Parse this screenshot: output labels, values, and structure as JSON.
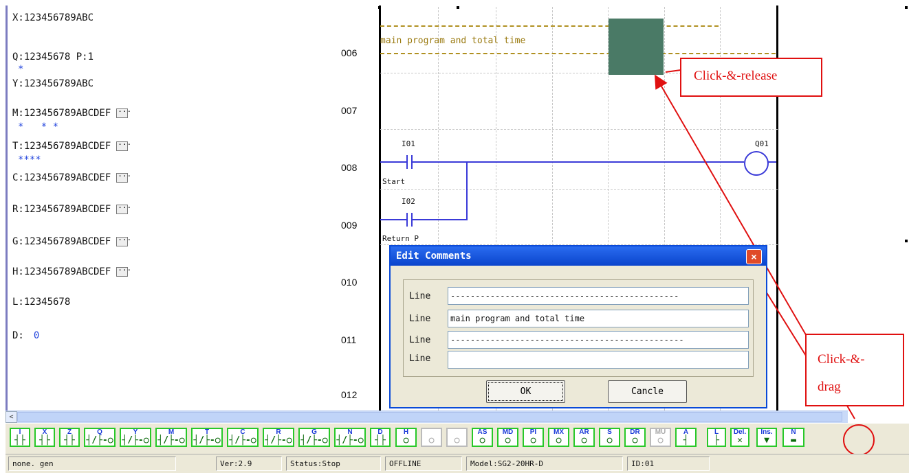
{
  "registers": [
    {
      "text": "X:123456789ABC",
      "more": false
    },
    {
      "text": "Q:12345678 P:1",
      "more": false
    },
    {
      "text": "Y:123456789ABC",
      "more": false
    },
    {
      "text": "M:123456789ABCDEF",
      "more": true
    },
    {
      "text": "T:123456789ABCDEF",
      "more": true
    },
    {
      "text": "C:123456789ABCDEF",
      "more": true
    },
    {
      "text": "R:123456789ABCDEF",
      "more": true
    },
    {
      "text": "G:123456789ABCDEF",
      "more": true
    },
    {
      "text": "H:123456789ABCDEF",
      "more": true
    },
    {
      "text": "L:12345678",
      "more": false
    },
    {
      "text": "D:",
      "more": false,
      "value": "0"
    }
  ],
  "register_markers": [
    "*",
    "*   * *",
    "****"
  ],
  "row_numbers": [
    "006",
    "007",
    "008",
    "009",
    "010",
    "011",
    "012"
  ],
  "ladder": {
    "comment_text": "main program and total time",
    "contacts": [
      {
        "id": "I01",
        "comment": "Start"
      },
      {
        "id": "I02",
        "comment": "Return P"
      }
    ],
    "coil": "Q01"
  },
  "callouts": {
    "release": "Click-&-release",
    "drag_line1": "Click-&-",
    "drag_line2": "drag"
  },
  "dialog": {
    "title": "Edit Comments",
    "close_glyph": "×",
    "lines": [
      {
        "label": "Line",
        "value": "----------------------------------------------"
      },
      {
        "label": "Line",
        "value": "main program and total time"
      },
      {
        "label": "Line",
        "value": "-----------------------------------------------"
      },
      {
        "label": "Line",
        "value": ""
      }
    ],
    "ok_label": "OK",
    "cancel_label": "Cancle"
  },
  "scrollbar": {
    "left_arrow": "<"
  },
  "toolbar": {
    "buttons": [
      {
        "name": "contact-i",
        "top": "I",
        "sym": "┤├"
      },
      {
        "name": "contact-x",
        "top": "X",
        "sym": "┤├"
      },
      {
        "name": "contact-z",
        "top": "Z",
        "sym": "┤├"
      },
      {
        "name": "coil-q",
        "top": "Q",
        "sym": "┤/├-○"
      },
      {
        "name": "coil-y",
        "top": "Y",
        "sym": "┤/├-○"
      },
      {
        "name": "coil-m",
        "top": "M",
        "sym": "┤/├-○"
      },
      {
        "name": "coil-t",
        "top": "T",
        "sym": "┤/├-○"
      },
      {
        "name": "coil-c",
        "top": "C",
        "sym": "┤/├-○"
      },
      {
        "name": "coil-r",
        "top": "R",
        "sym": "┤/├-○"
      },
      {
        "name": "coil-g",
        "top": "G",
        "sym": "┤/├-○"
      },
      {
        "name": "coil-n",
        "top": "N",
        "sym": "┤/├-○"
      },
      {
        "name": "contact-d",
        "top": "D",
        "sym": "┤├"
      },
      {
        "name": "coil-h",
        "top": "H",
        "sym": "○"
      },
      {
        "name": "func-gray-1",
        "top": "",
        "sym": "○",
        "disabled": true
      },
      {
        "name": "func-gray-2",
        "top": "",
        "sym": "○",
        "disabled": true
      },
      {
        "name": "func-as",
        "top": "AS",
        "sym": "○"
      },
      {
        "name": "func-md",
        "top": "MD",
        "sym": "○"
      },
      {
        "name": "func-pi",
        "top": "PI",
        "sym": "○"
      },
      {
        "name": "func-mx",
        "top": "MX",
        "sym": "○"
      },
      {
        "name": "func-ar",
        "top": "AR",
        "sym": "○"
      },
      {
        "name": "func-s",
        "top": "S",
        "sym": "○"
      },
      {
        "name": "func-dr",
        "top": "DR",
        "sym": "○"
      },
      {
        "name": "func-mu",
        "top": "MU",
        "sym": "○",
        "disabled": true
      },
      {
        "name": "line-a",
        "top": "A",
        "sym": "┤"
      },
      {
        "name": "line-l",
        "top": "L",
        "sym": "├"
      },
      {
        "name": "delete",
        "top": "Del.",
        "sym": "✕"
      },
      {
        "name": "insert",
        "top": "Ins.",
        "sym": "▼"
      },
      {
        "name": "comment-n",
        "top": "N",
        "sym": "▬"
      }
    ]
  },
  "statusbar": {
    "file": "none. gen",
    "version": "Ver:2.9",
    "status": "Status:Stop",
    "conn": "OFFLINE",
    "model": "Model:SG2-20HR-D",
    "id": "ID:01"
  }
}
